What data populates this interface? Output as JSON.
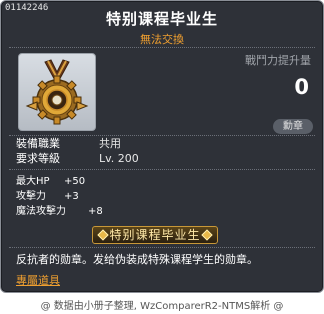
{
  "item": {
    "code": "01142246",
    "name": "特别课程毕业生",
    "trade": "無法交換",
    "power_label": "戰鬥力提升量",
    "power_value": "0",
    "category_badge": "勳章",
    "job_label": "裝備職業",
    "job_value": "共用",
    "level_label": "要求等級",
    "level_value": "Lv. 200",
    "stats": [
      {
        "label": "最大HP",
        "value": "+50"
      },
      {
        "label": "攻擊力",
        "value": "+3"
      },
      {
        "label": "魔法攻擊力",
        "value": "+8"
      }
    ],
    "set_name": "特别课程毕业生",
    "description": "反抗者的勋章。发给伪装成特殊课程学生的勋章。",
    "link_text": "專屬道具"
  },
  "footer": "@ 数据由小册子整理, WzComparerR2-NTMS解析 @",
  "colors": {
    "background": "#2e3138",
    "title": "#ffffff",
    "accent": "#f0a030",
    "gold": "#e8b848"
  },
  "icons": [
    "medal-icon",
    "gem-icon"
  ]
}
